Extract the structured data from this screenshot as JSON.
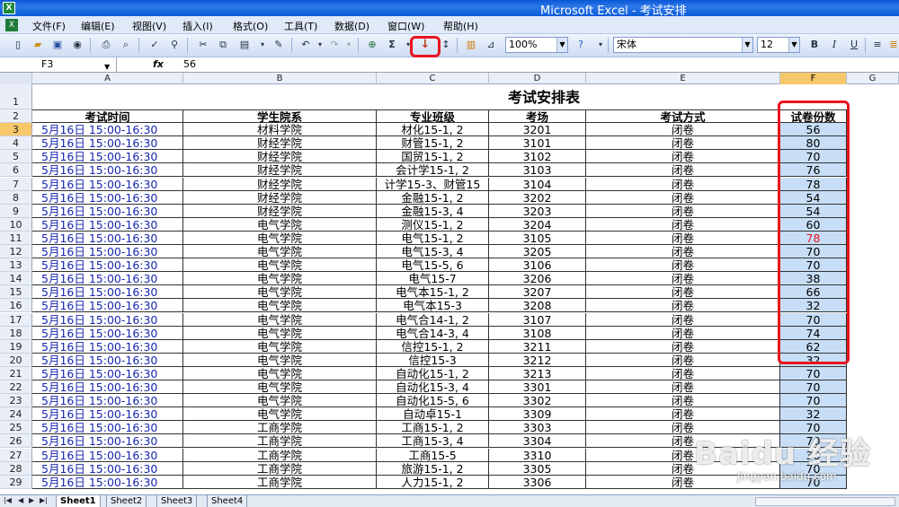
{
  "window": {
    "title": "Microsoft Excel - 考试安排"
  },
  "menu": [
    "文件(F)",
    "编辑(E)",
    "视图(V)",
    "插入(I)",
    "格式(O)",
    "工具(T)",
    "数据(D)",
    "窗口(W)",
    "帮助(H)"
  ],
  "toolbar": {
    "zoom": "100%",
    "font_name": "宋体",
    "font_size": "12",
    "sum_symbol": "Σ"
  },
  "formula_bar": {
    "name_box": "F3",
    "fx": "fx",
    "value": "56"
  },
  "columns": [
    "A",
    "B",
    "C",
    "D",
    "E",
    "F",
    "G"
  ],
  "sheet": {
    "title": "考试安排表",
    "headers": [
      "考试时间",
      "学生院系",
      "专业班级",
      "考场",
      "考试方式",
      "试卷份数"
    ],
    "rows": [
      [
        "5月16日 15:00-16:30",
        "材料学院",
        "材化15-1, 2",
        "3201",
        "闭卷",
        "56"
      ],
      [
        "5月16日 15:00-16:30",
        "财经学院",
        "财管15-1, 2",
        "3101",
        "闭卷",
        "80"
      ],
      [
        "5月16日 15:00-16:30",
        "财经学院",
        "国贸15-1, 2",
        "3102",
        "闭卷",
        "70"
      ],
      [
        "5月16日 15:00-16:30",
        "财经学院",
        "会计学15-1, 2",
        "3103",
        "闭卷",
        "76"
      ],
      [
        "5月16日 15:00-16:30",
        "财经学院",
        "计学15-3、财管15",
        "3104",
        "闭卷",
        "78"
      ],
      [
        "5月16日 15:00-16:30",
        "财经学院",
        "金融15-1, 2",
        "3202",
        "闭卷",
        "54"
      ],
      [
        "5月16日 15:00-16:30",
        "财经学院",
        "金融15-3, 4",
        "3203",
        "闭卷",
        "54"
      ],
      [
        "5月16日 15:00-16:30",
        "电气学院",
        "测仪15-1, 2",
        "3204",
        "闭卷",
        "60"
      ],
      [
        "5月16日 15:00-16:30",
        "电气学院",
        "电气15-1, 2",
        "3105",
        "闭卷",
        "78"
      ],
      [
        "5月16日 15:00-16:30",
        "电气学院",
        "电气15-3, 4",
        "3205",
        "闭卷",
        "70"
      ],
      [
        "5月16日 15:00-16:30",
        "电气学院",
        "电气15-5, 6",
        "3106",
        "闭卷",
        "70"
      ],
      [
        "5月16日 15:00-16:30",
        "电气学院",
        "电气15-7",
        "3206",
        "闭卷",
        "38"
      ],
      [
        "5月16日 15:00-16:30",
        "电气学院",
        "电气本15-1, 2",
        "3207",
        "闭卷",
        "66"
      ],
      [
        "5月16日 15:00-16:30",
        "电气学院",
        "电气本15-3",
        "3208",
        "闭卷",
        "32"
      ],
      [
        "5月16日 15:00-16:30",
        "电气学院",
        "电气合14-1, 2",
        "3107",
        "闭卷",
        "70"
      ],
      [
        "5月16日 15:00-16:30",
        "电气学院",
        "电气合14-3, 4",
        "3108",
        "闭卷",
        "74"
      ],
      [
        "5月16日 15:00-16:30",
        "电气学院",
        "信控15-1, 2",
        "3211",
        "闭卷",
        "62"
      ],
      [
        "5月16日 15:00-16:30",
        "电气学院",
        "信控15-3",
        "3212",
        "闭卷",
        "32"
      ],
      [
        "5月16日 15:00-16:30",
        "电气学院",
        "自动化15-1, 2",
        "3213",
        "闭卷",
        "70"
      ],
      [
        "5月16日 15:00-16:30",
        "电气学院",
        "自动化15-3, 4",
        "3301",
        "闭卷",
        "70"
      ],
      [
        "5月16日 15:00-16:30",
        "电气学院",
        "自动化15-5, 6",
        "3302",
        "闭卷",
        "70"
      ],
      [
        "5月16日 15:00-16:30",
        "电气学院",
        "自动卓15-1",
        "3309",
        "闭卷",
        "32"
      ],
      [
        "5月16日 15:00-16:30",
        "工商学院",
        "工商15-1, 2",
        "3303",
        "闭卷",
        "70"
      ],
      [
        "5月16日 15:00-16:30",
        "工商学院",
        "工商15-3, 4",
        "3304",
        "闭卷",
        "70"
      ],
      [
        "5月16日 15:00-16:30",
        "工商学院",
        "工商15-5",
        "3310",
        "闭卷",
        "36"
      ],
      [
        "5月16日 15:00-16:30",
        "工商学院",
        "旅游15-1, 2",
        "3305",
        "闭卷",
        "70"
      ],
      [
        "5月16日 15:00-16:30",
        "工商学院",
        "人力15-1, 2",
        "3306",
        "闭卷",
        "70"
      ]
    ],
    "highlight": {
      "color": "#e8141e",
      "row_index": 8
    }
  },
  "sheet_tabs": [
    "Sheet1",
    "Sheet2",
    "Sheet3",
    "Sheet4"
  ],
  "active_tab": "Sheet1",
  "watermark": {
    "logo": "Baidu 经验",
    "url": "jingyan.baidu.com"
  }
}
